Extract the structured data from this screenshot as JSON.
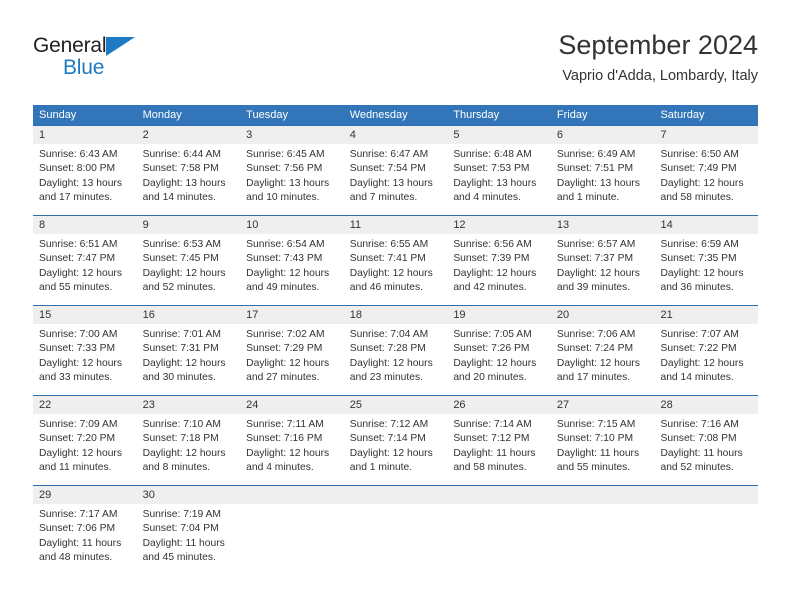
{
  "brand": {
    "name_top": "General",
    "name_bottom": "Blue",
    "accent_color": "#1f7ac4"
  },
  "header": {
    "title": "September 2024",
    "subtitle": "Vaprio d'Adda, Lombardy, Italy"
  },
  "theme": {
    "header_bg": "#3275b8",
    "daynum_bg": "#efefef",
    "separator": "#2f6fae",
    "text": "#333333"
  },
  "weekdays": [
    "Sunday",
    "Monday",
    "Tuesday",
    "Wednesday",
    "Thursday",
    "Friday",
    "Saturday"
  ],
  "weeks": [
    [
      {
        "day": "1",
        "sunrise": "Sunrise: 6:43 AM",
        "sunset": "Sunset: 8:00 PM",
        "daylight1": "Daylight: 13 hours",
        "daylight2": "and 17 minutes."
      },
      {
        "day": "2",
        "sunrise": "Sunrise: 6:44 AM",
        "sunset": "Sunset: 7:58 PM",
        "daylight1": "Daylight: 13 hours",
        "daylight2": "and 14 minutes."
      },
      {
        "day": "3",
        "sunrise": "Sunrise: 6:45 AM",
        "sunset": "Sunset: 7:56 PM",
        "daylight1": "Daylight: 13 hours",
        "daylight2": "and 10 minutes."
      },
      {
        "day": "4",
        "sunrise": "Sunrise: 6:47 AM",
        "sunset": "Sunset: 7:54 PM",
        "daylight1": "Daylight: 13 hours",
        "daylight2": "and 7 minutes."
      },
      {
        "day": "5",
        "sunrise": "Sunrise: 6:48 AM",
        "sunset": "Sunset: 7:53 PM",
        "daylight1": "Daylight: 13 hours",
        "daylight2": "and 4 minutes."
      },
      {
        "day": "6",
        "sunrise": "Sunrise: 6:49 AM",
        "sunset": "Sunset: 7:51 PM",
        "daylight1": "Daylight: 13 hours",
        "daylight2": "and 1 minute."
      },
      {
        "day": "7",
        "sunrise": "Sunrise: 6:50 AM",
        "sunset": "Sunset: 7:49 PM",
        "daylight1": "Daylight: 12 hours",
        "daylight2": "and 58 minutes."
      }
    ],
    [
      {
        "day": "8",
        "sunrise": "Sunrise: 6:51 AM",
        "sunset": "Sunset: 7:47 PM",
        "daylight1": "Daylight: 12 hours",
        "daylight2": "and 55 minutes."
      },
      {
        "day": "9",
        "sunrise": "Sunrise: 6:53 AM",
        "sunset": "Sunset: 7:45 PM",
        "daylight1": "Daylight: 12 hours",
        "daylight2": "and 52 minutes."
      },
      {
        "day": "10",
        "sunrise": "Sunrise: 6:54 AM",
        "sunset": "Sunset: 7:43 PM",
        "daylight1": "Daylight: 12 hours",
        "daylight2": "and 49 minutes."
      },
      {
        "day": "11",
        "sunrise": "Sunrise: 6:55 AM",
        "sunset": "Sunset: 7:41 PM",
        "daylight1": "Daylight: 12 hours",
        "daylight2": "and 46 minutes."
      },
      {
        "day": "12",
        "sunrise": "Sunrise: 6:56 AM",
        "sunset": "Sunset: 7:39 PM",
        "daylight1": "Daylight: 12 hours",
        "daylight2": "and 42 minutes."
      },
      {
        "day": "13",
        "sunrise": "Sunrise: 6:57 AM",
        "sunset": "Sunset: 7:37 PM",
        "daylight1": "Daylight: 12 hours",
        "daylight2": "and 39 minutes."
      },
      {
        "day": "14",
        "sunrise": "Sunrise: 6:59 AM",
        "sunset": "Sunset: 7:35 PM",
        "daylight1": "Daylight: 12 hours",
        "daylight2": "and 36 minutes."
      }
    ],
    [
      {
        "day": "15",
        "sunrise": "Sunrise: 7:00 AM",
        "sunset": "Sunset: 7:33 PM",
        "daylight1": "Daylight: 12 hours",
        "daylight2": "and 33 minutes."
      },
      {
        "day": "16",
        "sunrise": "Sunrise: 7:01 AM",
        "sunset": "Sunset: 7:31 PM",
        "daylight1": "Daylight: 12 hours",
        "daylight2": "and 30 minutes."
      },
      {
        "day": "17",
        "sunrise": "Sunrise: 7:02 AM",
        "sunset": "Sunset: 7:29 PM",
        "daylight1": "Daylight: 12 hours",
        "daylight2": "and 27 minutes."
      },
      {
        "day": "18",
        "sunrise": "Sunrise: 7:04 AM",
        "sunset": "Sunset: 7:28 PM",
        "daylight1": "Daylight: 12 hours",
        "daylight2": "and 23 minutes."
      },
      {
        "day": "19",
        "sunrise": "Sunrise: 7:05 AM",
        "sunset": "Sunset: 7:26 PM",
        "daylight1": "Daylight: 12 hours",
        "daylight2": "and 20 minutes."
      },
      {
        "day": "20",
        "sunrise": "Sunrise: 7:06 AM",
        "sunset": "Sunset: 7:24 PM",
        "daylight1": "Daylight: 12 hours",
        "daylight2": "and 17 minutes."
      },
      {
        "day": "21",
        "sunrise": "Sunrise: 7:07 AM",
        "sunset": "Sunset: 7:22 PM",
        "daylight1": "Daylight: 12 hours",
        "daylight2": "and 14 minutes."
      }
    ],
    [
      {
        "day": "22",
        "sunrise": "Sunrise: 7:09 AM",
        "sunset": "Sunset: 7:20 PM",
        "daylight1": "Daylight: 12 hours",
        "daylight2": "and 11 minutes."
      },
      {
        "day": "23",
        "sunrise": "Sunrise: 7:10 AM",
        "sunset": "Sunset: 7:18 PM",
        "daylight1": "Daylight: 12 hours",
        "daylight2": "and 8 minutes."
      },
      {
        "day": "24",
        "sunrise": "Sunrise: 7:11 AM",
        "sunset": "Sunset: 7:16 PM",
        "daylight1": "Daylight: 12 hours",
        "daylight2": "and 4 minutes."
      },
      {
        "day": "25",
        "sunrise": "Sunrise: 7:12 AM",
        "sunset": "Sunset: 7:14 PM",
        "daylight1": "Daylight: 12 hours",
        "daylight2": "and 1 minute."
      },
      {
        "day": "26",
        "sunrise": "Sunrise: 7:14 AM",
        "sunset": "Sunset: 7:12 PM",
        "daylight1": "Daylight: 11 hours",
        "daylight2": "and 58 minutes."
      },
      {
        "day": "27",
        "sunrise": "Sunrise: 7:15 AM",
        "sunset": "Sunset: 7:10 PM",
        "daylight1": "Daylight: 11 hours",
        "daylight2": "and 55 minutes."
      },
      {
        "day": "28",
        "sunrise": "Sunrise: 7:16 AM",
        "sunset": "Sunset: 7:08 PM",
        "daylight1": "Daylight: 11 hours",
        "daylight2": "and 52 minutes."
      }
    ],
    [
      {
        "day": "29",
        "sunrise": "Sunrise: 7:17 AM",
        "sunset": "Sunset: 7:06 PM",
        "daylight1": "Daylight: 11 hours",
        "daylight2": "and 48 minutes."
      },
      {
        "day": "30",
        "sunrise": "Sunrise: 7:19 AM",
        "sunset": "Sunset: 7:04 PM",
        "daylight1": "Daylight: 11 hours",
        "daylight2": "and 45 minutes."
      },
      {
        "day": "",
        "sunrise": "",
        "sunset": "",
        "daylight1": "",
        "daylight2": ""
      },
      {
        "day": "",
        "sunrise": "",
        "sunset": "",
        "daylight1": "",
        "daylight2": ""
      },
      {
        "day": "",
        "sunrise": "",
        "sunset": "",
        "daylight1": "",
        "daylight2": ""
      },
      {
        "day": "",
        "sunrise": "",
        "sunset": "",
        "daylight1": "",
        "daylight2": ""
      },
      {
        "day": "",
        "sunrise": "",
        "sunset": "",
        "daylight1": "",
        "daylight2": ""
      }
    ]
  ]
}
